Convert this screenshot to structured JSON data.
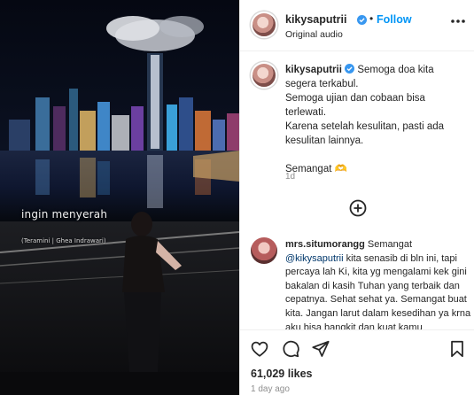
{
  "header": {
    "username": "kikysaputrii",
    "dot": "•",
    "follow_label": "Follow",
    "subtitle": "Original audio"
  },
  "video": {
    "overlay_title": "ingin menyerah",
    "overlay_credit": "(Teramini | Ghea Indrawari)"
  },
  "post": {
    "username": "kikysaputrii",
    "lines": [
      "Semoga doa kita",
      "segera terkabul.",
      "Semoga ujian dan cobaan bisa",
      "terlewati.",
      "Karena setelah kesulitan, pasti ada",
      "kesulitan lainnya.",
      "",
      "Semangat 🫶"
    ],
    "time": "1d"
  },
  "comment": {
    "username": "mrs.situmorangg",
    "first_text": " Semangat",
    "mention": "@kikysaputrii",
    "body": " kita senasib di bln ini, tapi percaya lah Ki, kita yg mengalami kek gini bakalan di kasih Tuhan yang terbaik dan cepatnya. Sehat sehat ya. Semangat buat kita. Jangan larut dalam kesedihan ya krna aku bisa bangkit dan kuat kamu"
  },
  "footer": {
    "likes": "61,029 likes",
    "ago": "1 day ago"
  },
  "icons": {
    "verified": "verified-badge-icon",
    "more": "more-options-icon",
    "add_comment": "plus-circle-icon",
    "like": "heart-icon",
    "comment": "comment-icon",
    "share": "send-icon",
    "save": "bookmark-icon"
  },
  "colors": {
    "accent": "#0095f6",
    "verified": "#3897f0",
    "muted": "#8e8e8e"
  }
}
